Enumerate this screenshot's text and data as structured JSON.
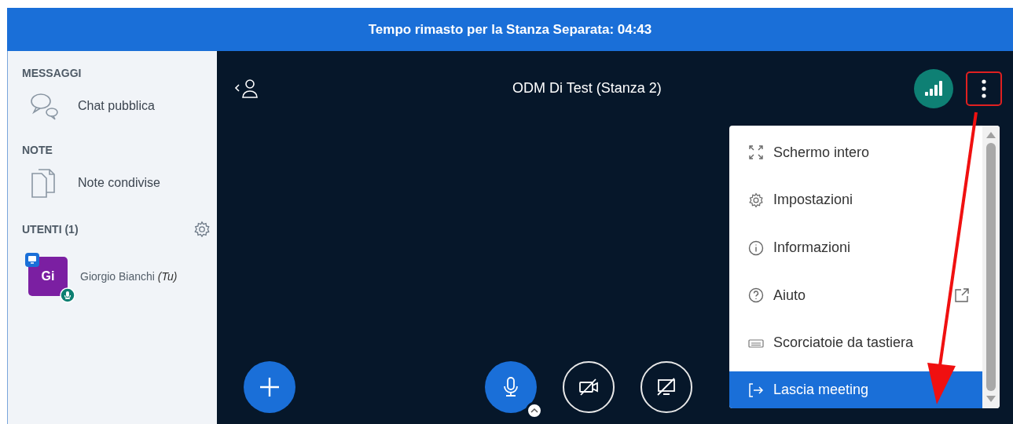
{
  "timer_bar": {
    "text": "Tempo rimasto per la Stanza Separata: 04:43"
  },
  "sidebar": {
    "sections": [
      {
        "heading": "MESSAGGI",
        "items": [
          {
            "kind": "chat",
            "label": "Chat pubblica"
          }
        ]
      },
      {
        "heading": "NOTE",
        "items": [
          {
            "kind": "notes",
            "label": "Note condivise"
          }
        ]
      }
    ],
    "users": {
      "heading": "UTENTI (1)",
      "list": [
        {
          "initials": "Gi",
          "name": "Giorgio Bianchi",
          "suffix": "(Tu)",
          "color": "#7b1fa2",
          "presenter": true,
          "mic": true
        }
      ]
    }
  },
  "main": {
    "title": "ODM Di Test (Stanza 2)",
    "menu": {
      "items": [
        {
          "kind": "fullscreen",
          "label": "Schermo intero",
          "selected": false,
          "external": false
        },
        {
          "kind": "settings",
          "label": "Impostazioni",
          "selected": false,
          "external": false
        },
        {
          "kind": "info",
          "label": "Informazioni",
          "selected": false,
          "external": false
        },
        {
          "kind": "help",
          "label": "Aiuto",
          "selected": false,
          "external": true
        },
        {
          "kind": "keyboard",
          "label": "Scorciatoie da tastiera",
          "selected": false,
          "external": false
        },
        {
          "kind": "leave",
          "label": "Lascia meeting",
          "selected": true,
          "external": false
        }
      ]
    },
    "controls": [
      {
        "kind": "actions",
        "on": true
      },
      {
        "kind": "mic",
        "on": true
      },
      {
        "kind": "camera",
        "on": false
      },
      {
        "kind": "screen",
        "on": false
      }
    ]
  }
}
